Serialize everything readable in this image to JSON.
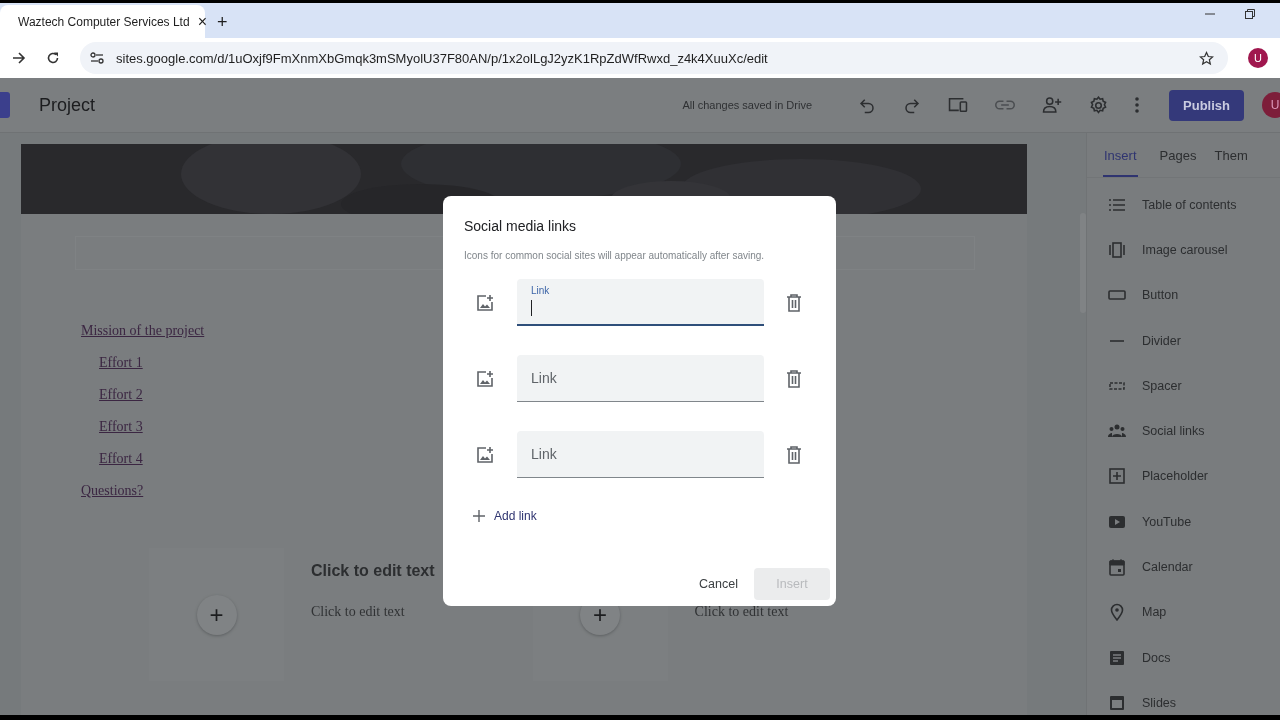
{
  "browser": {
    "tab_title": "Waztech Computer Services Ltd",
    "tab_close": "×",
    "new_tab": "+",
    "url": "sites.google.com/d/1uOxjf9FmXnmXbGmqk3mSMyolU37F80AN/p/1x2olLgJ2yzK1RpZdWfRwxd_z4k4XuuXc/edit",
    "profile": "U"
  },
  "app_bar": {
    "title": "Project",
    "save_status": "All changes saved in Drive",
    "publish": "Publish",
    "avatar": "U"
  },
  "page": {
    "toc": [
      {
        "label": "Mission of the project",
        "children": [
          {
            "label": "Effort 1"
          },
          {
            "label": "Effort 2"
          },
          {
            "label": "Effort 3"
          },
          {
            "label": "Effort 4"
          }
        ]
      },
      {
        "label": "Questions?"
      }
    ],
    "columns": [
      {
        "heading": "Click to edit text",
        "body": "Click to edit text",
        "add": "+"
      },
      {
        "body": "Click to edit text",
        "add": "+"
      }
    ]
  },
  "side_panel": {
    "tabs": [
      {
        "label": "Insert",
        "selected": true
      },
      {
        "label": "Pages",
        "selected": false
      },
      {
        "label": "Them",
        "selected": false
      }
    ],
    "items": [
      "Table of contents",
      "Image carousel",
      "Button",
      "Divider",
      "Spacer",
      "Social links",
      "Placeholder",
      "YouTube",
      "Calendar",
      "Map",
      "Docs",
      "Slides"
    ]
  },
  "dialog": {
    "title": "Social media links",
    "subtitle": "Icons for common social sites will appear automatically after saving.",
    "links": [
      {
        "label": "Link",
        "focused": true
      },
      {
        "label": "Link",
        "focused": false
      },
      {
        "label": "Link",
        "focused": false
      }
    ],
    "add_link": "Add link",
    "cancel": "Cancel",
    "insert": {
      "label": "Insert",
      "disabled": true
    }
  }
}
